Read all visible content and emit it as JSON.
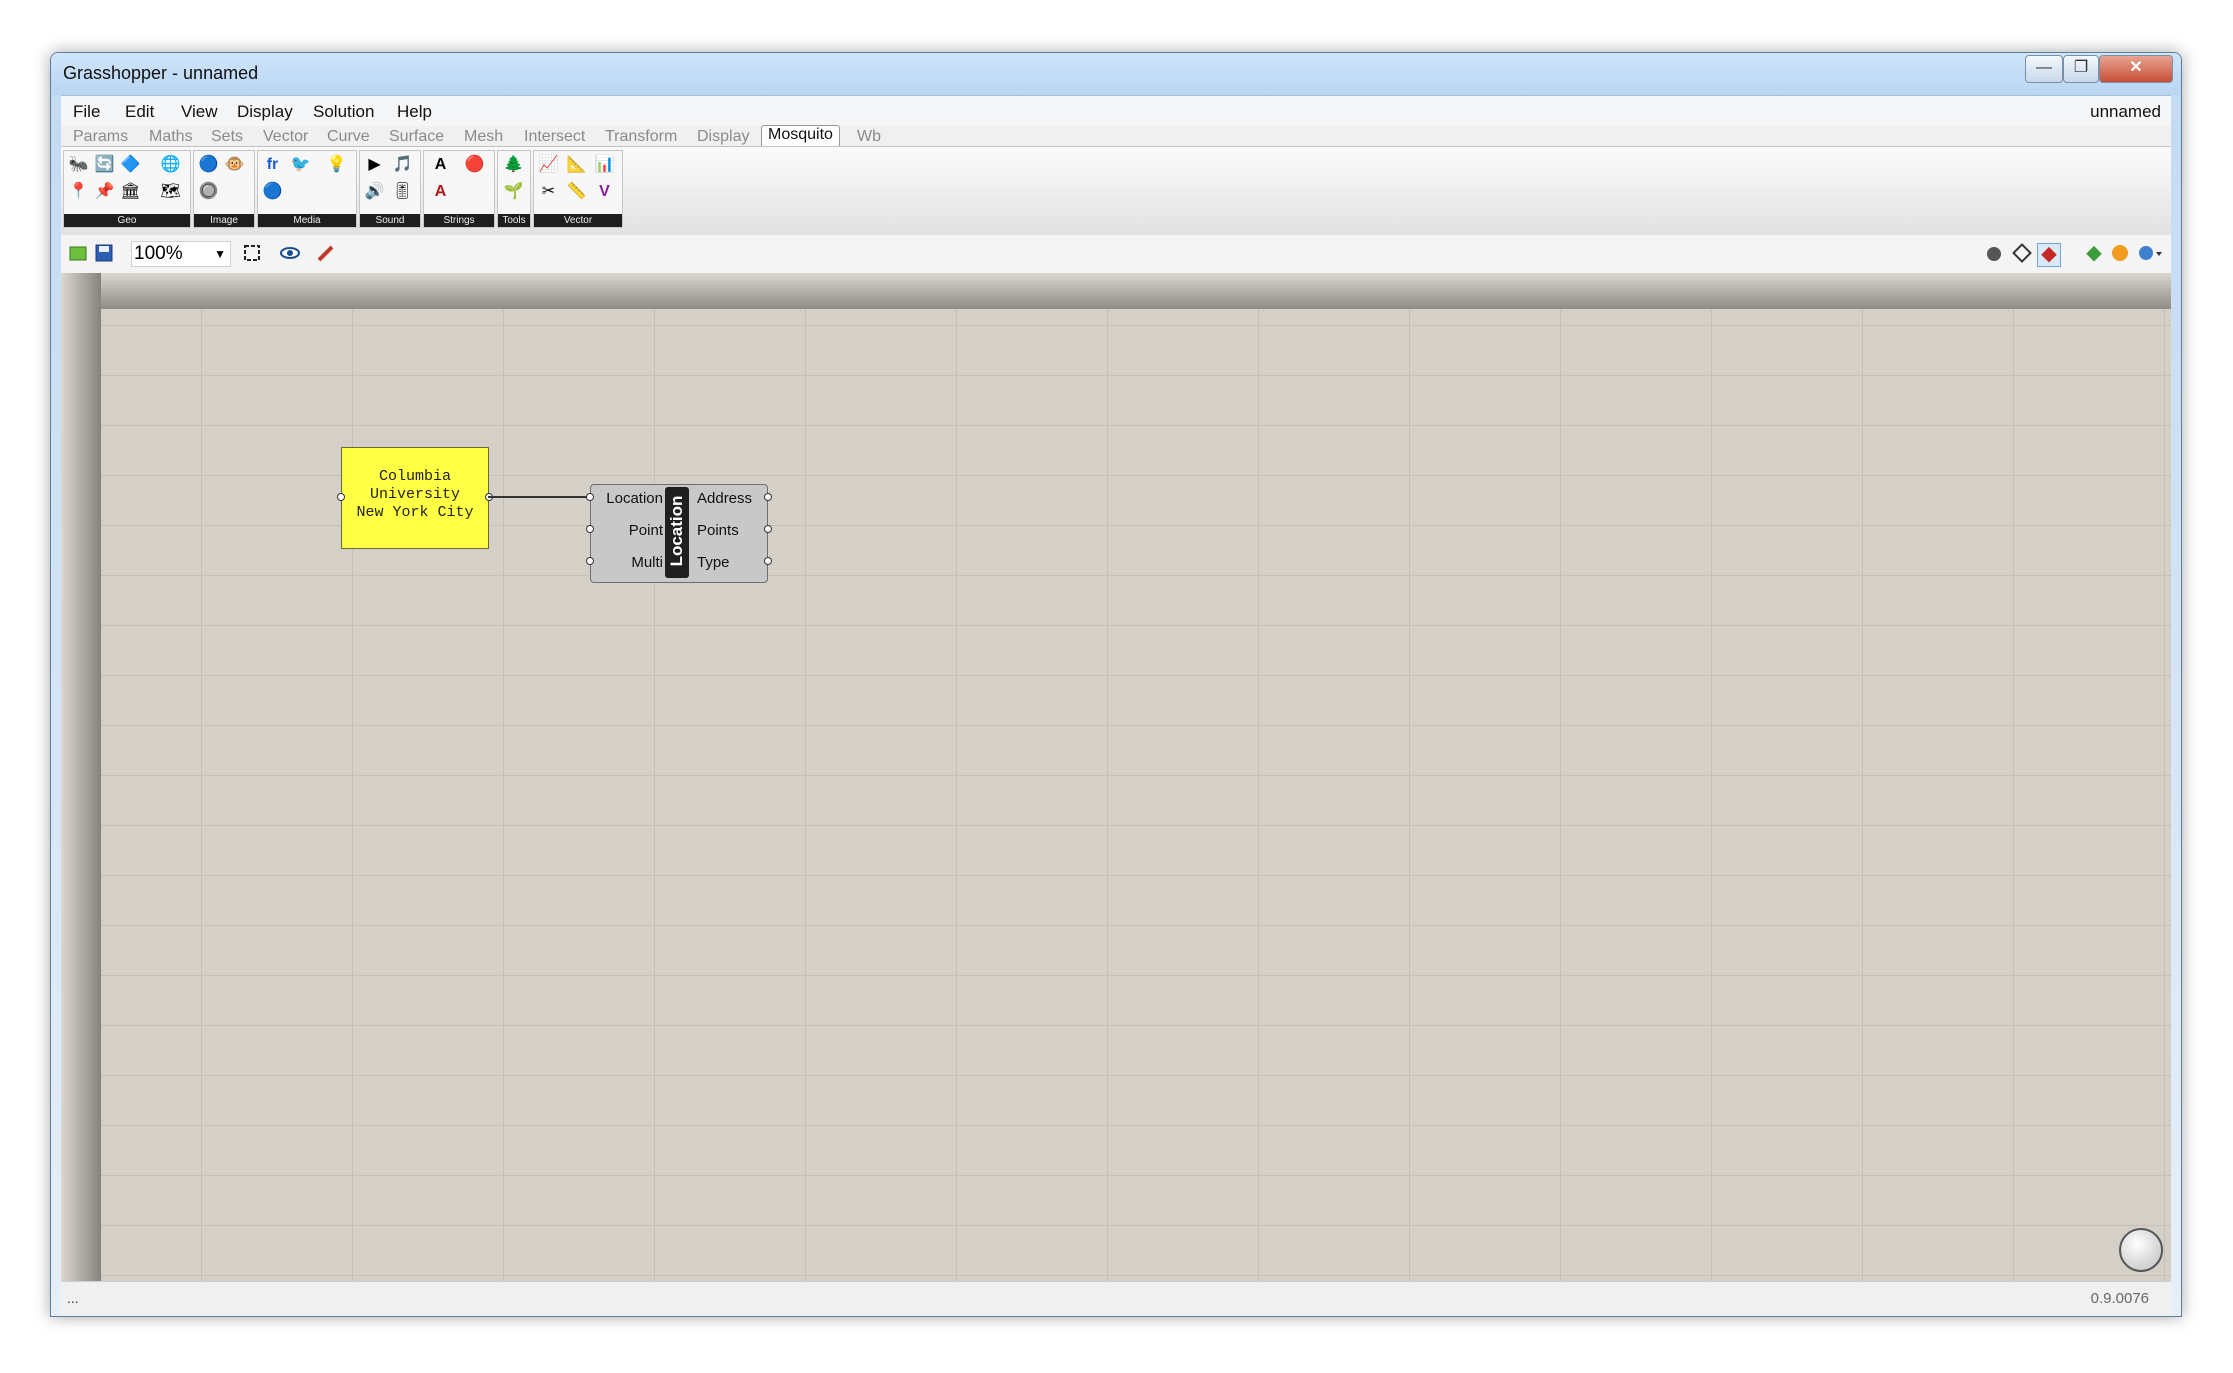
{
  "window": {
    "title": "Grasshopper - unnamed",
    "doc_name": "unnamed",
    "buttons": {
      "minimize": "—",
      "maximize": "❐",
      "close": "✕"
    }
  },
  "menu": [
    "File",
    "Edit",
    "View",
    "Display",
    "Solution",
    "Help"
  ],
  "tabs": [
    {
      "label": "Params",
      "active": false
    },
    {
      "label": "Maths",
      "active": false
    },
    {
      "label": "Sets",
      "active": false
    },
    {
      "label": "Vector",
      "active": false
    },
    {
      "label": "Curve",
      "active": false
    },
    {
      "label": "Surface",
      "active": false
    },
    {
      "label": "Mesh",
      "active": false
    },
    {
      "label": "Intersect",
      "active": false
    },
    {
      "label": "Transform",
      "active": false
    },
    {
      "label": "Display",
      "active": false
    },
    {
      "label": "Mosquito",
      "active": true
    },
    {
      "label": "Wb",
      "active": false
    }
  ],
  "ribbon_groups": [
    {
      "label": "Geo",
      "icons": [
        "🐜",
        "🔄",
        "🔷",
        "🌐",
        "📍",
        "📌",
        "🏛",
        "🗺"
      ]
    },
    {
      "label": "Image",
      "icons": [
        "🔵",
        "🐵",
        "🔘"
      ]
    },
    {
      "label": "Media",
      "icons": [
        "fr",
        "🐦",
        "💡",
        "🔵"
      ]
    },
    {
      "label": "Sound",
      "icons": [
        "▶",
        "🎵",
        "🔊",
        "🎚"
      ]
    },
    {
      "label": "Strings",
      "icons": [
        "A",
        "🔴",
        "A"
      ]
    },
    {
      "label": "Tools",
      "icons": [
        "🌲",
        "🌱"
      ]
    },
    {
      "label": "Vector",
      "icons": [
        "📈",
        "📐",
        "📊",
        "✂",
        "📏",
        "V"
      ]
    }
  ],
  "toolbar": {
    "zoom": "100%",
    "zoom_caret": "▼"
  },
  "canvas": {
    "panel": {
      "lines": [
        "Columbia",
        "University",
        "New York City"
      ]
    },
    "component": {
      "nickname": "Location",
      "inputs": [
        "Location",
        "Point",
        "Multi"
      ],
      "outputs": [
        "Address",
        "Points",
        "Type"
      ]
    }
  },
  "status": {
    "left": "...",
    "version": "0.9.0076"
  }
}
